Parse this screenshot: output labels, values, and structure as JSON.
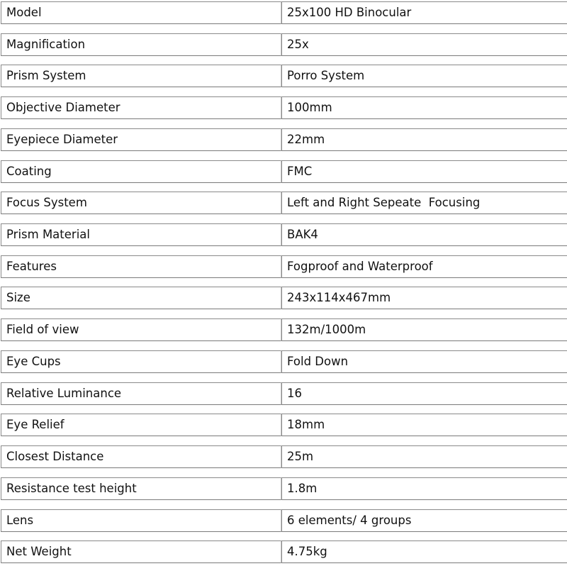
{
  "specs": [
    {
      "label": "Model",
      "value": "25x100 HD Binocular"
    },
    {
      "label": "Magnification",
      "value": "25x"
    },
    {
      "label": "Prism System",
      "value": "Porro System"
    },
    {
      "label": "Objective Diameter",
      "value": "100mm"
    },
    {
      "label": "Eyepiece Diameter",
      "value": "22mm"
    },
    {
      "label": "Coating",
      "value": "FMC"
    },
    {
      "label": "Focus System",
      "value": "Left and Right Sepeate  Focusing"
    },
    {
      "label": "Prism Material",
      "value": "BAK4"
    },
    {
      "label": "Features",
      "value": "Fogproof and Waterproof"
    },
    {
      "label": "Size",
      "value": "243x114x467mm"
    },
    {
      "label": "Field of view",
      "value": "132m/1000m"
    },
    {
      "label": "Eye Cups",
      "value": "Fold Down"
    },
    {
      "label": "Relative Luminance",
      "value": "16"
    },
    {
      "label": "Eye Relief",
      "value": "18mm"
    },
    {
      "label": "Closest Distance",
      "value": "25m"
    },
    {
      "label": "Resistance test height",
      "value": "1.8m"
    },
    {
      "label": "Lens",
      "value": "6 elements/ 4 groups"
    },
    {
      "label": "Net Weight",
      "value": "4.75kg"
    }
  ]
}
